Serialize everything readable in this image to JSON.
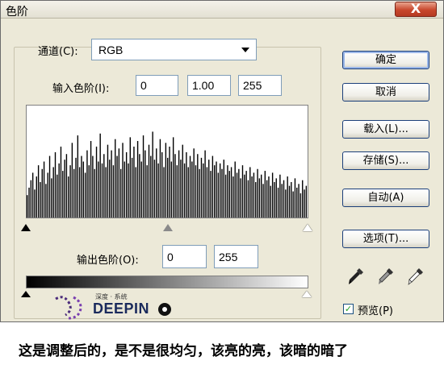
{
  "window": {
    "title": "色阶",
    "close_label": "X"
  },
  "channel": {
    "label": "通道(C):",
    "value": "RGB"
  },
  "input_levels": {
    "label": "输入色阶(I):",
    "black": "0",
    "gamma": "1.00",
    "white": "255"
  },
  "output_levels": {
    "label": "输出色阶(O):",
    "black": "0",
    "white": "255"
  },
  "buttons": {
    "ok": "确定",
    "cancel": "取消",
    "load": "载入(L)...",
    "save": "存储(S)...",
    "auto": "自动(A)",
    "options": "选项(T)..."
  },
  "preview": {
    "label": "预览(P)",
    "checked": true
  },
  "logo": {
    "small_text": "深度 · 系统",
    "main_text": "DEEPIN"
  },
  "caption": "这是调整后的，是不是很均匀，该亮的亮，该暗的暗了",
  "histogram": {
    "description_values": [
      12,
      16,
      20,
      24,
      15,
      22,
      28,
      19,
      26,
      30,
      18,
      24,
      33,
      21,
      27,
      35,
      23,
      29,
      38,
      25,
      31,
      34,
      22,
      28,
      40,
      26,
      32,
      44,
      27,
      33,
      30,
      24,
      36,
      28,
      41,
      33,
      26,
      38,
      30,
      45,
      29,
      34,
      27,
      39,
      31,
      36,
      28,
      42,
      33,
      37,
      26,
      40,
      30,
      35,
      29,
      43,
      32,
      38,
      27,
      41,
      34,
      30,
      44,
      36,
      28,
      39,
      33,
      46,
      31,
      37,
      29,
      42,
      35,
      27,
      40,
      32,
      38,
      30,
      43,
      34,
      28,
      36,
      31,
      39,
      29,
      35,
      27,
      33,
      30,
      37,
      28,
      34,
      26,
      32,
      29,
      36,
      27,
      31,
      25,
      33,
      28,
      30,
      24,
      29,
      26,
      31,
      23,
      28,
      25,
      27,
      22,
      30,
      24,
      26,
      21,
      28,
      23,
      25,
      20,
      27,
      22,
      24,
      19,
      26,
      21,
      23,
      18,
      25,
      20,
      22,
      17,
      24,
      19,
      21,
      16,
      23,
      18,
      20,
      15,
      22,
      17,
      19,
      14,
      21,
      16,
      18,
      13,
      20,
      15,
      17
    ],
    "max": 60
  }
}
